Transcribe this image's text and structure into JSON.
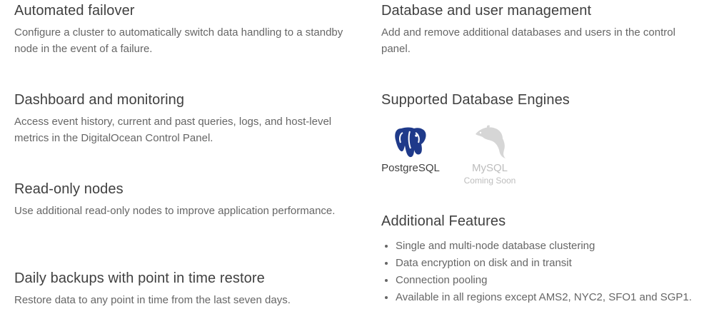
{
  "left_features": [
    {
      "title": "Automated failover",
      "desc": "Configure a cluster to automatically switch data handling to a standby node in the event of a failure."
    },
    {
      "title": "Dashboard and monitoring",
      "desc": "Access event history, current and past queries, logs, and host-level metrics in the DigitalOcean Control Panel."
    },
    {
      "title": "Read-only nodes",
      "desc": "Use additional read-only nodes to improve application performance."
    },
    {
      "title": "Daily backups with point in time restore",
      "desc": "Restore data to any point in time from the last seven days."
    }
  ],
  "right": {
    "db_user_mgmt": {
      "title": "Database and user management",
      "desc": "Add and remove additional databases and users in the control panel."
    },
    "engines": {
      "title": "Supported Database Engines",
      "items": [
        {
          "name": "PostgreSQL",
          "icon": "postgresql-elephant-icon",
          "color": "#1f3a8a"
        },
        {
          "name": "MySQL",
          "status": "Coming Soon",
          "icon": "mysql-dolphin-icon",
          "color": "#d0d0d0"
        }
      ]
    },
    "additional": {
      "title": "Additional Features",
      "items": [
        "Single and multi-node database clustering",
        "Data encryption on disk and in transit",
        "Connection pooling",
        "Available in all regions except AMS2, NYC2, SFO1 and SGP1."
      ]
    }
  }
}
